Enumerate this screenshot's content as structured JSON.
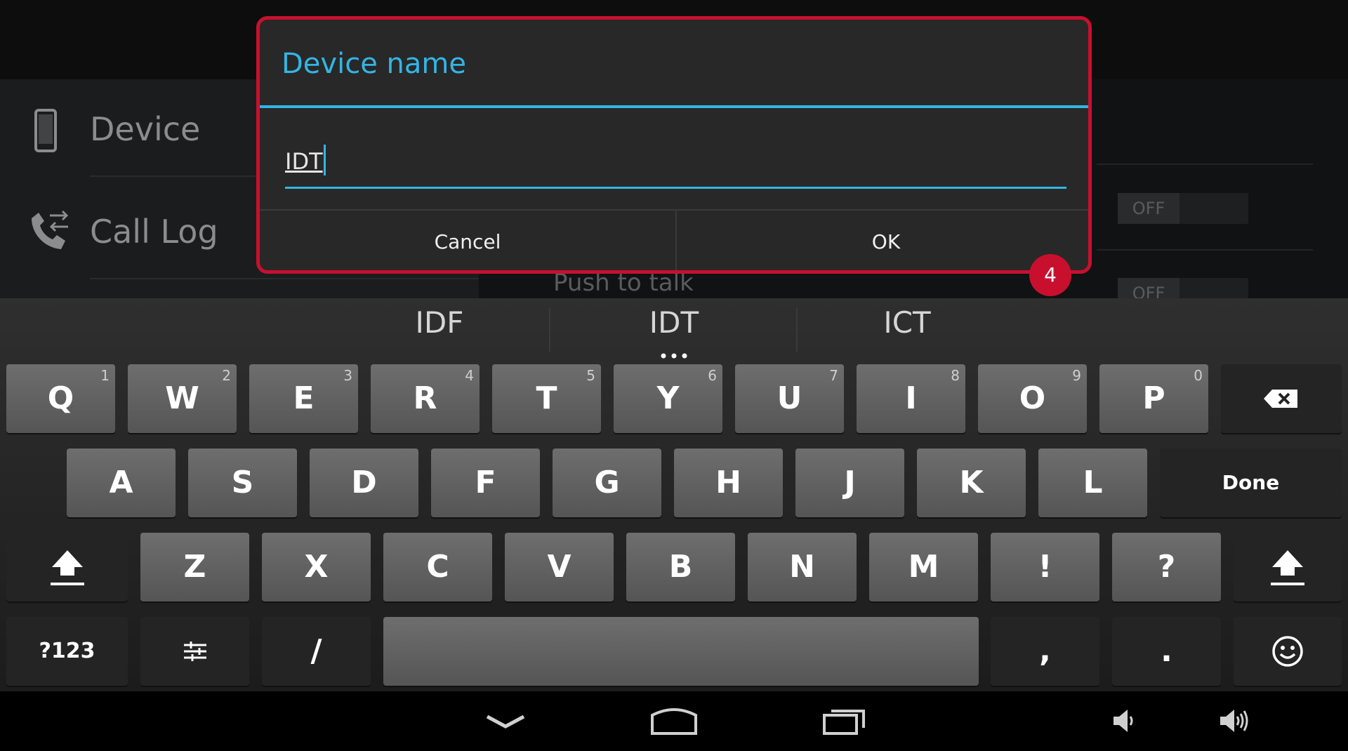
{
  "settings": {
    "nav_items": [
      {
        "label": "Device",
        "icon": "phone-icon"
      },
      {
        "label": "Call Log",
        "icon": "call-log-icon"
      }
    ],
    "toggle_off_label": "OFF",
    "push_to_talk_label": "Push to talk"
  },
  "dialog": {
    "title": "Device name",
    "input_value": "IDT",
    "cancel_label": "Cancel",
    "ok_label": "OK",
    "step_badge": "4"
  },
  "keyboard": {
    "suggestions": [
      "IDF",
      "IDT",
      "ICT"
    ],
    "row1": [
      {
        "label": "Q",
        "hint": "1"
      },
      {
        "label": "W",
        "hint": "2"
      },
      {
        "label": "E",
        "hint": "3"
      },
      {
        "label": "R",
        "hint": "4"
      },
      {
        "label": "T",
        "hint": "5"
      },
      {
        "label": "Y",
        "hint": "6"
      },
      {
        "label": "U",
        "hint": "7"
      },
      {
        "label": "I",
        "hint": "8"
      },
      {
        "label": "O",
        "hint": "9"
      },
      {
        "label": "P",
        "hint": "0"
      }
    ],
    "row2": [
      "A",
      "S",
      "D",
      "F",
      "G",
      "H",
      "J",
      "K",
      "L"
    ],
    "row3": [
      "Z",
      "X",
      "C",
      "V",
      "B",
      "N",
      "M",
      "!",
      "?"
    ],
    "done_label": "Done",
    "symbols_label": "?123",
    "slash_label": "/",
    "comma_label": ",",
    "period_label": ".",
    "icons": {
      "backspace": "backspace-icon",
      "shift": "shift-icon",
      "settings": "keyboard-settings-icon",
      "emoji": "emoji-icon"
    }
  },
  "navbar": {
    "icons": [
      "hide-keyboard-icon",
      "home-icon",
      "recent-apps-icon",
      "volume-down-icon",
      "volume-up-icon"
    ]
  },
  "colors": {
    "accent": "#33b5e5",
    "highlight": "#c8102e",
    "key_face": "#5f5f5f"
  }
}
